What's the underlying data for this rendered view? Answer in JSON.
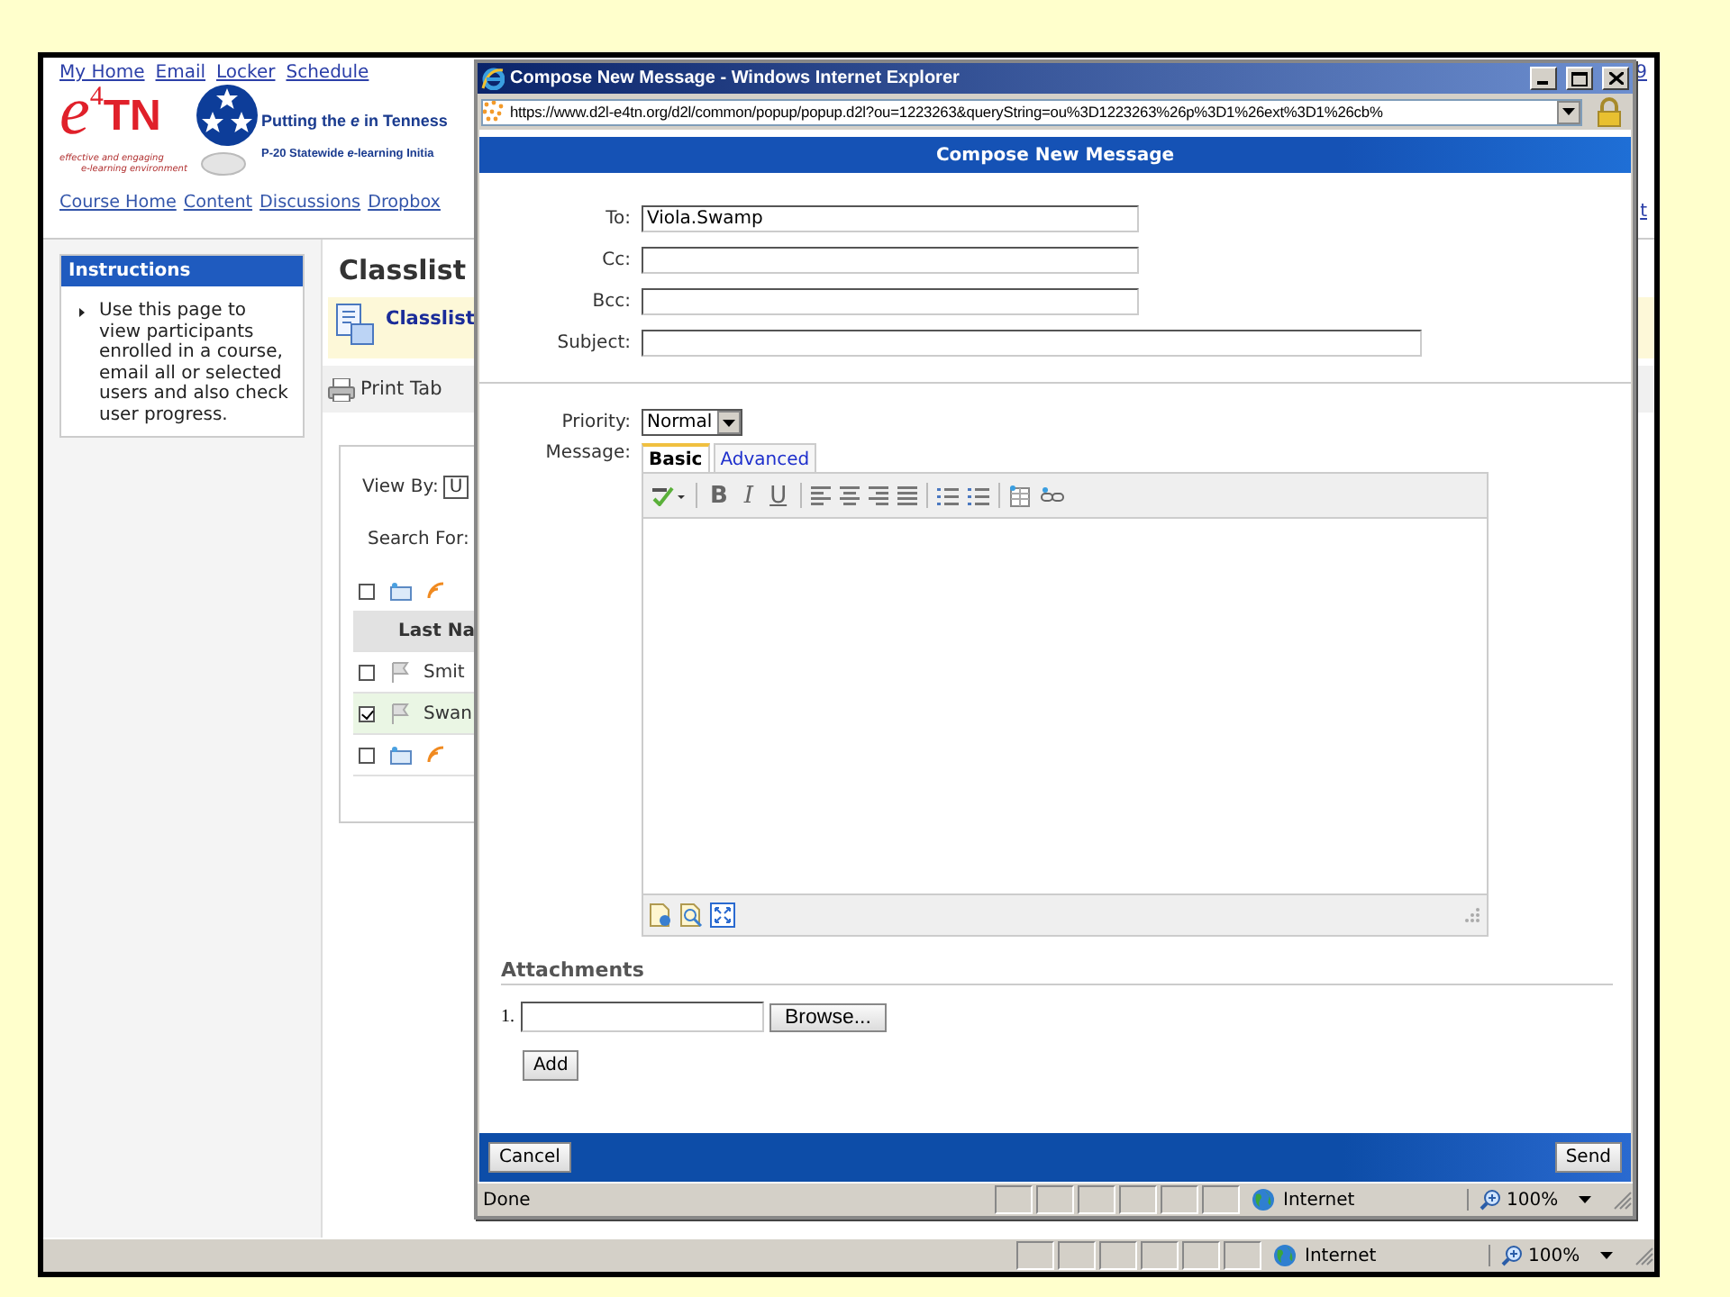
{
  "background_page": {
    "top_links": [
      "My Home",
      "Email",
      "Locker",
      "Schedule"
    ],
    "top_right_fragment": "9",
    "logo": {
      "letter": "e",
      "sup": "4",
      "word": "TN",
      "tagline": "Putting the *e* in Tenness",
      "subline": "P-20 Statewide *e*-learning Initia",
      "motto_1": "effective and engaging",
      "motto_2": "e-learning environment"
    },
    "nav_links": [
      "Course Home",
      "Content",
      "Discussions",
      "Dropbox"
    ],
    "nav_right_fragment": "t",
    "instructions": {
      "title": "Instructions",
      "text": "Use this page to view participants enrolled in a course, email all or selected users and also check user progress."
    },
    "page_title": "Classlist",
    "tab": "Classlist",
    "toolbar": {
      "print": "Print Tab"
    },
    "view_by": {
      "label": "View By:",
      "value": "U"
    },
    "search_label": "Search For:",
    "table": {
      "column": "Last Na",
      "action_rows": [
        {
          "checked": false
        },
        {
          "checked": false
        }
      ],
      "rows": [
        {
          "name": "Smit",
          "checked": false
        },
        {
          "name": "Swan",
          "checked": true
        }
      ]
    },
    "status_bar": {
      "zone": "Internet",
      "zoom": "100%"
    }
  },
  "popup": {
    "title": "Compose New Message - Windows Internet Explorer",
    "url": "https://www.d2l-e4tn.org/d2l/common/popup/popup.d2l?ou=1223263&queryString=ou%3D1223263%26p%3D1%26ext%3D1%26cb%",
    "header": "Compose New Message",
    "fields": [
      {
        "label": "To:",
        "value": "Viola.Swamp",
        "kind": "short"
      },
      {
        "label": "Cc:",
        "kind": "short"
      },
      {
        "label": "Bcc:",
        "kind": "short"
      },
      {
        "label": "Subject:",
        "kind": "long"
      }
    ],
    "priority": {
      "label": "Priority:",
      "value": "Normal"
    },
    "message": {
      "label": "Message:",
      "tabs": [
        {
          "label": "Basic",
          "selected": true
        },
        {
          "label": "Advanced",
          "selected": false
        }
      ],
      "format_buttons": [
        "B",
        "I",
        "U"
      ]
    },
    "attachments": {
      "title": "Attachments",
      "number": "1.",
      "browse": "Browse...",
      "add": "Add"
    },
    "footer": {
      "cancel": "Cancel",
      "send": "Send"
    },
    "status_bar": {
      "text": "Done",
      "zone": "Internet",
      "zoom": "100%"
    }
  }
}
